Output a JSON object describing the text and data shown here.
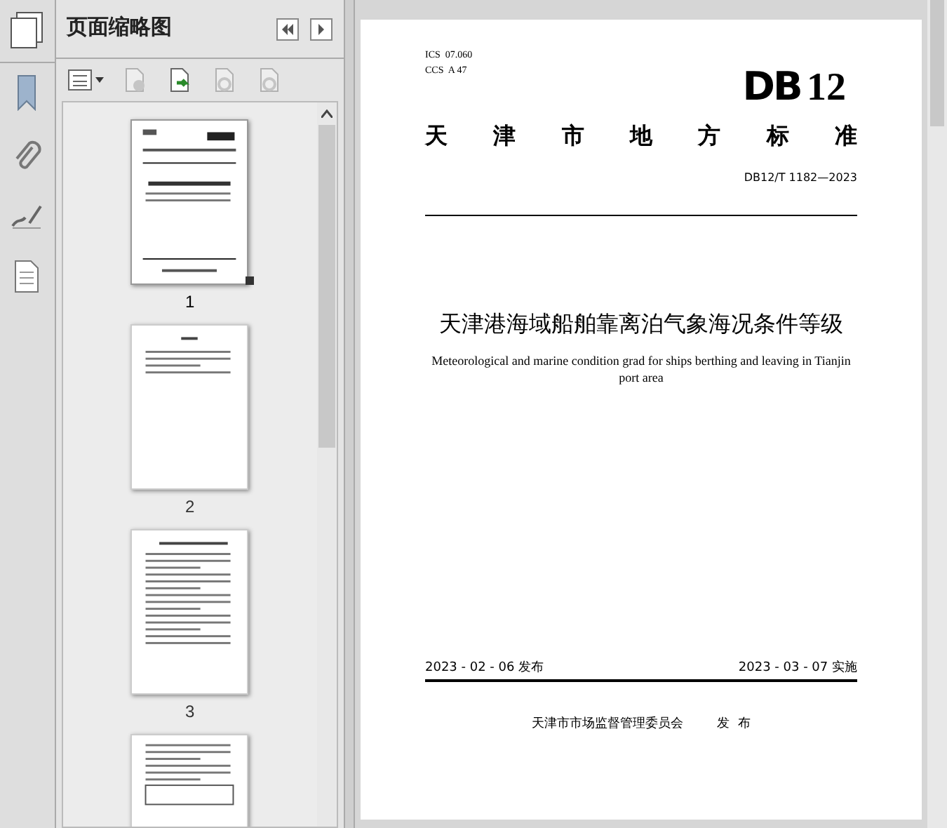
{
  "panel": {
    "title": "页面缩略图"
  },
  "thumbnails": [
    {
      "label": "1",
      "selected": true
    },
    {
      "label": "2",
      "selected": false
    },
    {
      "label": "3",
      "selected": false
    },
    {
      "selected": false
    }
  ],
  "document": {
    "codes": [
      "ICS  07.060",
      "CCS  A 47"
    ],
    "logo": {
      "prefix": "DB",
      "number": "12"
    },
    "heading_chars": [
      "天",
      "津",
      "市",
      "地",
      "方",
      "标",
      "准"
    ],
    "standard_number": "DB12/T 1182—2023",
    "title": "天津港海域船舶靠离泊气象海况条件等级",
    "subtitle": "Meteorological and marine condition grad for ships berthing and leaving in Tianjin port area",
    "issue_date": "2023 - 02 - 06 发布",
    "effective_date": "2023 - 03 - 07 实施",
    "issuer": "天津市市场监督管理委员会",
    "issuer_action": "发  布"
  }
}
